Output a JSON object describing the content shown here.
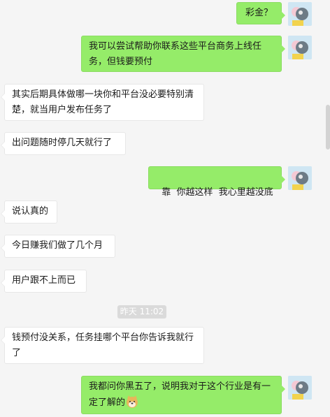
{
  "chat": {
    "messages": [
      {
        "side": "out",
        "text": "彩金？"
      },
      {
        "side": "out",
        "text": "我可以尝试帮助你联系这些平台商务上线任务，但钱要预付"
      },
      {
        "side": "in",
        "text": "其实后期具体做哪一块你和平台没必要特别清楚，就当用户发布任务了"
      },
      {
        "side": "in",
        "text": "出问题随时停几天就行了"
      },
      {
        "side": "out",
        "text": "靠  你越这样  我心里越没底"
      },
      {
        "side": "in",
        "text": "说认真的"
      },
      {
        "side": "in",
        "text": "今日赚我们做了几个月"
      },
      {
        "side": "in",
        "text": "用户跟不上而已"
      },
      {
        "side": "in",
        "text": "钱预付没关系，任务挂哪个平台你告诉我就行了"
      },
      {
        "side": "out",
        "text": "我都问你黑五了，说明我对于这个行业是有一定了解的",
        "emoji": "doge-emoji"
      }
    ],
    "timestamp": "昨天 11:02"
  },
  "colors": {
    "outgoing_bubble": "#95ec69",
    "incoming_bubble": "#ffffff",
    "background": "#f5f5f5"
  }
}
